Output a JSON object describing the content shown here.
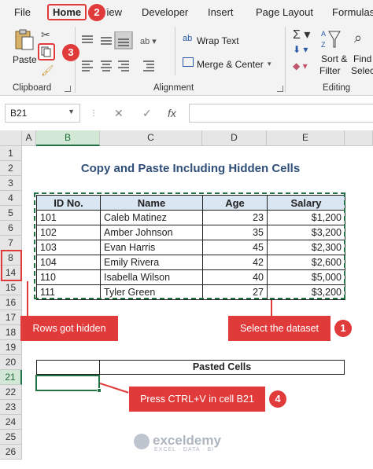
{
  "tabs": {
    "file": "File",
    "home": "Home",
    "view": "View",
    "developer": "Developer",
    "insert": "Insert",
    "page_layout": "Page Layout",
    "formulas": "Formulas"
  },
  "ribbon": {
    "paste": "Paste",
    "wrap_text": "Wrap Text",
    "merge_center": "Merge & Center",
    "sort": "Sort &",
    "filter": "Filter",
    "find": "Find",
    "select": "Select",
    "groups": {
      "clipboard": "Clipboard",
      "alignment": "Alignment",
      "editing": "Editing"
    }
  },
  "formula_bar": {
    "name_box": "B21",
    "fx": "fx",
    "cancel": "✕",
    "enter": "✓",
    "formula": ""
  },
  "columns": [
    "A",
    "B",
    "C",
    "D",
    "E"
  ],
  "rows": [
    "1",
    "2",
    "3",
    "4",
    "5",
    "6",
    "7",
    "8",
    "14",
    "15",
    "16",
    "17",
    "18",
    "19",
    "20",
    "21",
    "22",
    "23",
    "24",
    "25",
    "26"
  ],
  "sheet": {
    "title": "Copy and Paste Including Hidden Cells",
    "headers": [
      "ID No.",
      "Name",
      "Age",
      "Salary"
    ],
    "records": [
      {
        "id": "101",
        "name": "Caleb Matinez",
        "age": "23",
        "salary": "$1,200"
      },
      {
        "id": "102",
        "name": "Amber Johnson",
        "age": "35",
        "salary": "$3,200"
      },
      {
        "id": "103",
        "name": "Evan Harris",
        "age": "45",
        "salary": "$2,300"
      },
      {
        "id": "104",
        "name": "Emily Rivera",
        "age": "42",
        "salary": "$2,600"
      },
      {
        "id": "110",
        "name": "Isabella Wilson",
        "age": "40",
        "salary": "$5,000"
      },
      {
        "id": "111",
        "name": "Tyler Green",
        "age": "27",
        "salary": "$3,200"
      }
    ],
    "pasted_label": "Pasted Cells"
  },
  "annotations": {
    "rows_hidden": "Rows got hidden",
    "select_dataset": "Select the dataset",
    "press_ctrl_v": "Press CTRL+V in cell B21",
    "step1": "1",
    "step2": "2",
    "step3": "3",
    "step4": "4"
  },
  "watermark": {
    "name": "exceldemy",
    "tagline": "EXCEL · DATA · BI"
  },
  "colors": {
    "accent_red": "#e03a3a",
    "excel_green": "#217346",
    "header_fill": "#dbe6f3",
    "title_blue": "#2f4f7a"
  }
}
